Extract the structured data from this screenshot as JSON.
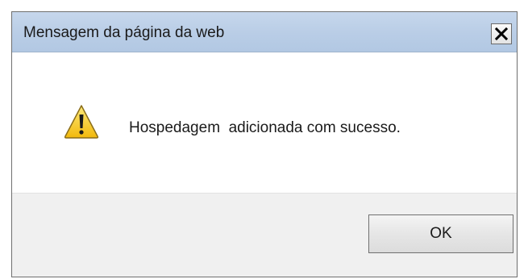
{
  "dialog": {
    "title": "Mensagem da página da web",
    "message": "Hospedagem  adicionada com sucesso.",
    "ok_label": "OK",
    "icon": "warning-icon",
    "close_icon": "close-icon"
  },
  "colors": {
    "titlebar": "#b9cde6",
    "footer": "#f0f0f0",
    "warning_yellow": "#f5c518"
  }
}
